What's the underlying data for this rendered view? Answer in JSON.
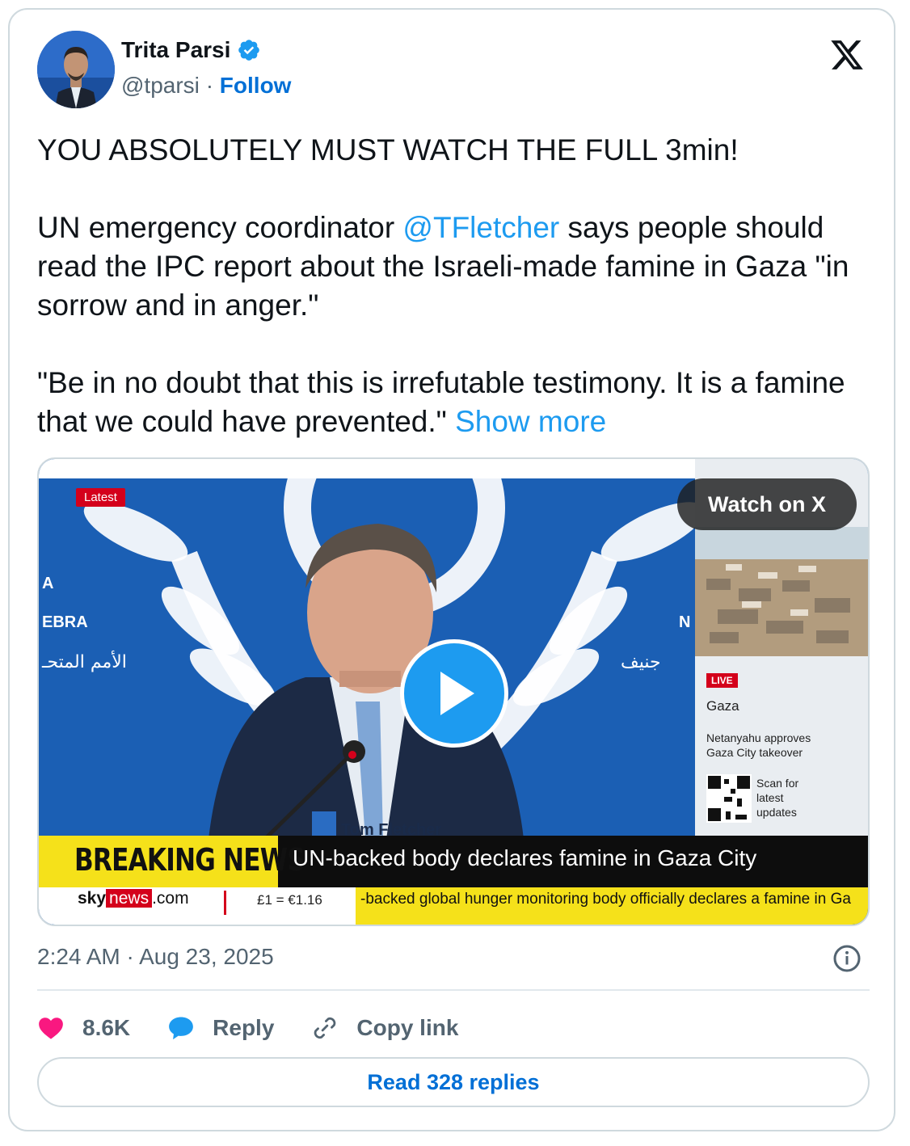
{
  "author": {
    "name": "Trita Parsi",
    "handle": "@tparsi",
    "separator": "·",
    "follow_label": "Follow"
  },
  "tweet": {
    "line1": "YOU ABSOLUTELY MUST WATCH THE FULL 3min!",
    "para2_before": "UN emergency coordinator ",
    "mention": "@TFletcher",
    "para2_after": " says people should read the IPC report about the Israeli-made famine in Gaza \"in sorrow and in anger.\"",
    "para3": "\"Be in no doubt that this is irrefutable testimony. It is a famine that we could have prevented.\" ",
    "show_more": "Show more"
  },
  "media": {
    "latest_tag": "Latest",
    "watch_on_x": "Watch on X",
    "live_badge": "LIVE",
    "side_place": "Gaza",
    "side_headline": "Netanyahu approves Gaza City takeover",
    "scan_text": "Scan for latest updates",
    "nameplate": "Tom Fletcher",
    "breaking_label": "BREAKING NEWS",
    "breaking_text": "UN-backed body declares famine in Gaza City",
    "ticker_sky": "sky",
    "ticker_news": "news",
    "ticker_dotcom": ".com",
    "ticker_rate": "£1 = €1.16",
    "ticker_scroll": "-backed global hunger monitoring body officially declares a famine in Ga"
  },
  "meta": {
    "timestamp": "2:24 AM · Aug 23, 2025"
  },
  "actions": {
    "likes": "8.6K",
    "reply": "Reply",
    "copy_link": "Copy link"
  },
  "read_replies": "Read 328 replies",
  "colors": {
    "link": "#1d9bf0",
    "follow": "#006fd6",
    "like": "#f91880",
    "breaking_yellow": "#f5e11a",
    "un_blue": "#1b5fb4"
  }
}
